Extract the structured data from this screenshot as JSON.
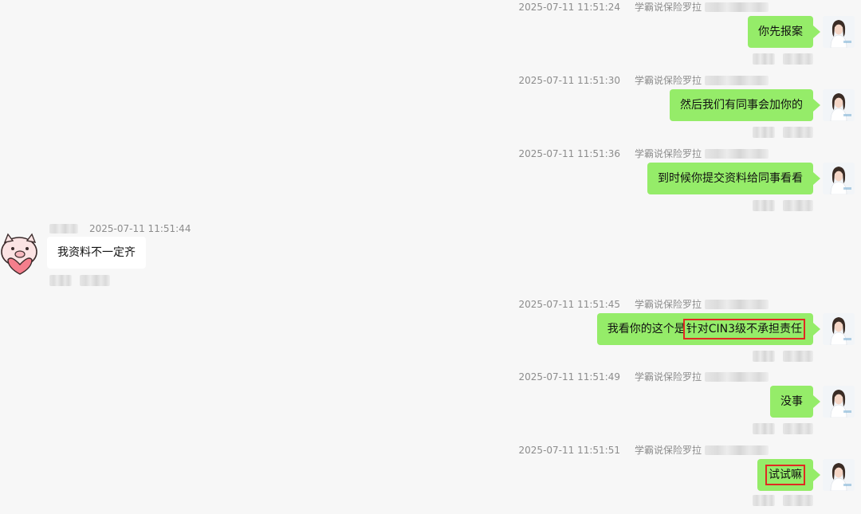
{
  "agent_name": "学霸说保险罗拉",
  "colors": {
    "outgoing_bubble": "#95ec69",
    "incoming_bubble": "#ffffff",
    "highlight_box": "#e02a22",
    "background": "#f7f7f7"
  },
  "messages": [
    {
      "time": "2025-07-11 11:51:24",
      "sender": "学霸说保险罗拉",
      "text": "你先报案"
    },
    {
      "time": "2025-07-11 11:51:30",
      "sender": "学霸说保险罗拉",
      "text": "然后我们有同事会加你的"
    },
    {
      "time": "2025-07-11 11:51:36",
      "sender": "学霸说保险罗拉",
      "text": "到时候你提交资料给同事看看"
    },
    {
      "time": "2025-07-11 11:51:44",
      "text": "我资料不一定齐"
    },
    {
      "time": "2025-07-11 11:51:45",
      "sender": "学霸说保险罗拉",
      "text_plain": "我看你的这个是",
      "text_highlight": "针对CIN3级不承担责任"
    },
    {
      "time": "2025-07-11 11:51:49",
      "sender": "学霸说保险罗拉",
      "text": "没事"
    },
    {
      "time": "2025-07-11 11:51:51",
      "sender": "学霸说保险罗拉",
      "text_highlight": "试试嘛"
    }
  ],
  "icons": {
    "agent_avatar": "woman-portrait-avatar",
    "customer_avatar": "pig-sticker-avatar"
  }
}
